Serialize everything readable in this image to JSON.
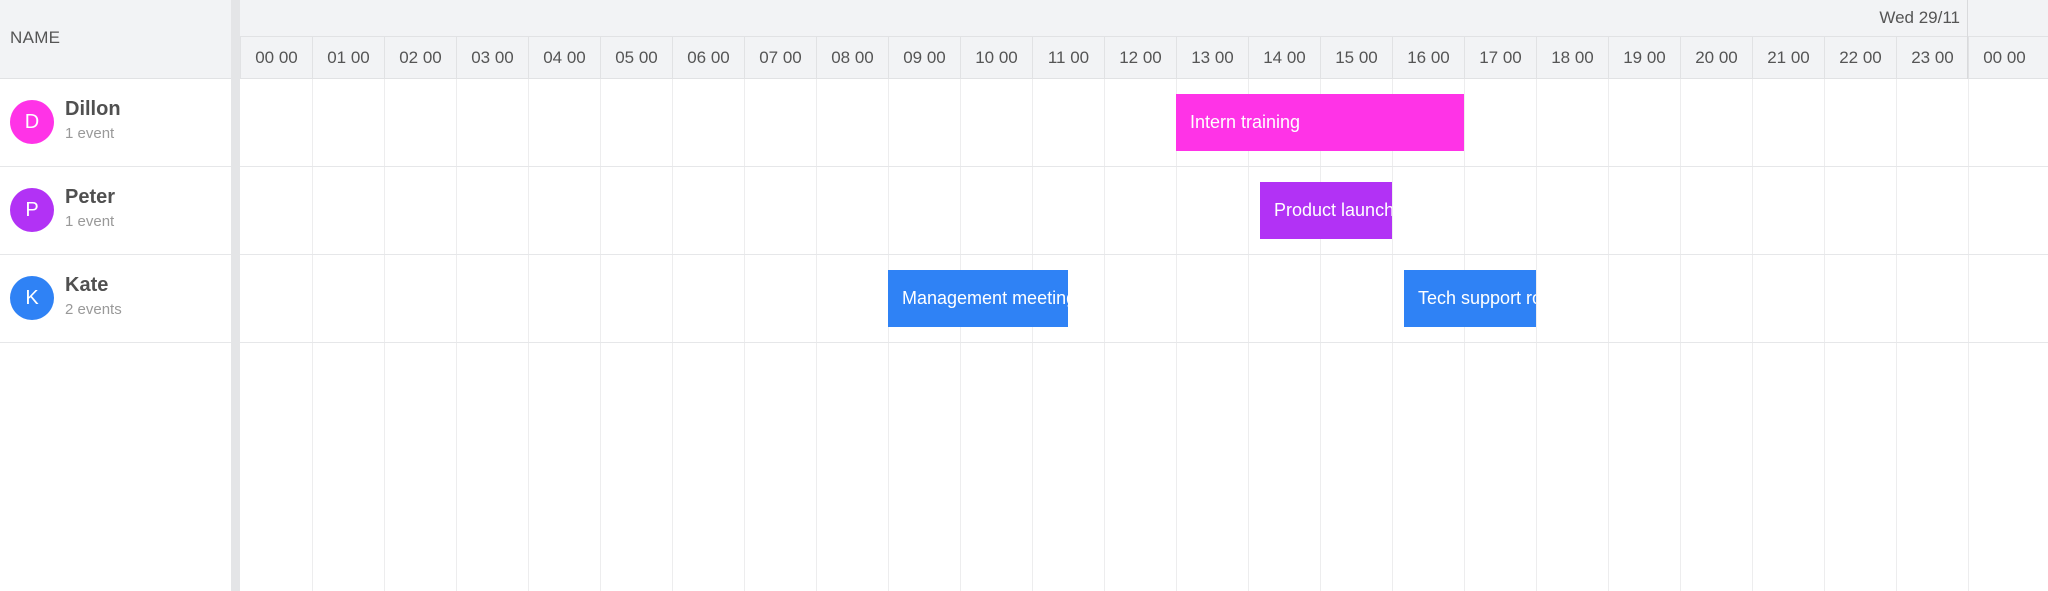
{
  "header": {
    "resource_column_label": "NAME",
    "day_label": "Wed 29/11"
  },
  "hours": [
    "00 00",
    "01 00",
    "02 00",
    "03 00",
    "04 00",
    "05 00",
    "06 00",
    "07 00",
    "08 00",
    "09 00",
    "10 00",
    "11 00",
    "12 00",
    "13 00",
    "14 00",
    "15 00",
    "16 00",
    "17 00",
    "18 00",
    "19 00",
    "20 00",
    "21 00",
    "22 00",
    "23 00",
    "00 00"
  ],
  "resources": [
    {
      "initial": "D",
      "name": "Dillon",
      "count": "1 event",
      "color": "#ff33e7"
    },
    {
      "initial": "P",
      "name": "Peter",
      "count": "1 event",
      "color": "#b232f5"
    },
    {
      "initial": "K",
      "name": "Kate",
      "count": "2 events",
      "color": "#2f82f5"
    }
  ],
  "events": [
    {
      "title": "Intern training",
      "resource": 0,
      "start": "13:00",
      "end": "17:00",
      "color": "#ff33e7"
    },
    {
      "title": "Product launch",
      "resource": 1,
      "start": "14:10",
      "end": "16:00",
      "color": "#b232f5"
    },
    {
      "title": "Management meeting",
      "resource": 2,
      "start": "09:00",
      "end": "11:30",
      "color": "#2f82f5"
    },
    {
      "title": "Tech support rotation",
      "resource": 2,
      "start": "16:10",
      "end": "18:00",
      "color": "#2f82f5"
    }
  ]
}
